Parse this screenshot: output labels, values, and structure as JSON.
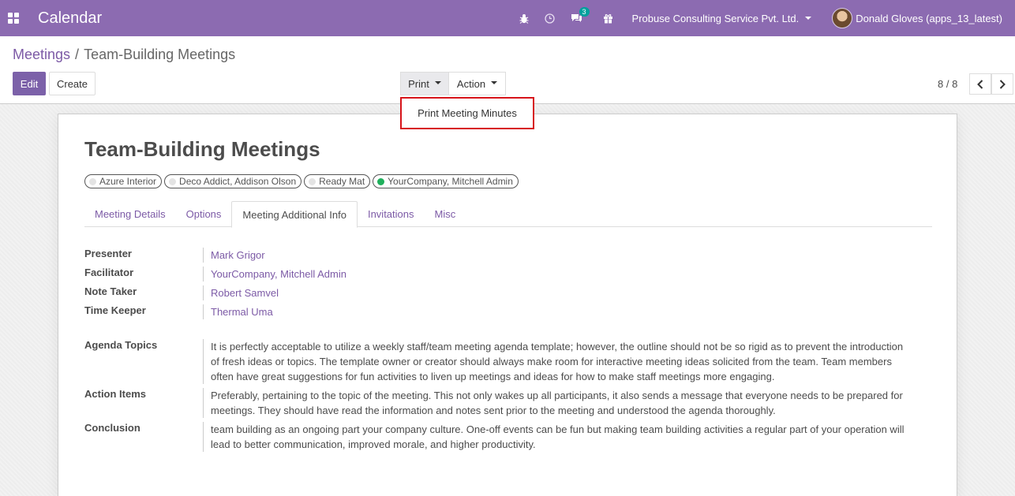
{
  "navbar": {
    "app_title": "Calendar",
    "message_count": "3",
    "company": "Probuse Consulting Service Pvt. Ltd.",
    "user": "Donald Gloves (apps_13_latest)"
  },
  "breadcrumb": {
    "parent": "Meetings",
    "separator": "/",
    "current": "Team-Building Meetings"
  },
  "buttons": {
    "edit": "Edit",
    "create": "Create",
    "print": "Print",
    "action": "Action"
  },
  "pager": {
    "value": "8 / 8"
  },
  "print_menu": {
    "items": [
      "Print Meeting Minutes"
    ]
  },
  "record": {
    "title": "Team-Building Meetings",
    "attendees": [
      "Azure Interior",
      "Deco Addict, Addison Olson",
      "Ready Mat",
      "YourCompany, Mitchell Admin"
    ]
  },
  "tabs": [
    "Meeting Details",
    "Options",
    "Meeting Additional Info",
    "Invitations",
    "Misc"
  ],
  "active_tab": "Meeting Additional Info",
  "fields": {
    "presenter": {
      "label": "Presenter",
      "value": "Mark Grigor"
    },
    "facilitator": {
      "label": "Facilitator",
      "value": "YourCompany, Mitchell Admin"
    },
    "note_taker": {
      "label": "Note Taker",
      "value": "Robert Samvel"
    },
    "time_keeper": {
      "label": "Time Keeper",
      "value": "Thermal Uma"
    },
    "agenda_topics": {
      "label": "Agenda Topics",
      "value": "It is perfectly acceptable to utilize a weekly staff/team meeting agenda template; however, the outline should not be so rigid as to prevent the introduction of fresh ideas or topics. The template owner or creator should always make room for interactive meeting ideas solicited from the team. Team members often have great suggestions for fun activities to liven up meetings and ideas for how to make staff meetings more engaging."
    },
    "action_items": {
      "label": "Action Items",
      "value": "Preferably, pertaining to the topic of the meeting. This not only wakes up all participants, it also sends a message that everyone needs to be prepared for meetings. They should have read the information and notes sent prior to the meeting and understood the agenda thoroughly."
    },
    "conclusion": {
      "label": "Conclusion",
      "value": "team building as an ongoing part your company culture. One-off events can be fun but making team building activities a regular part of your operation will lead to better communication, improved morale, and higher productivity."
    }
  },
  "colors": {
    "brand": "#8c6bb1",
    "link": "#7c5aa6",
    "highlight_border": "#d7141a",
    "status_green": "#1fb05c"
  }
}
